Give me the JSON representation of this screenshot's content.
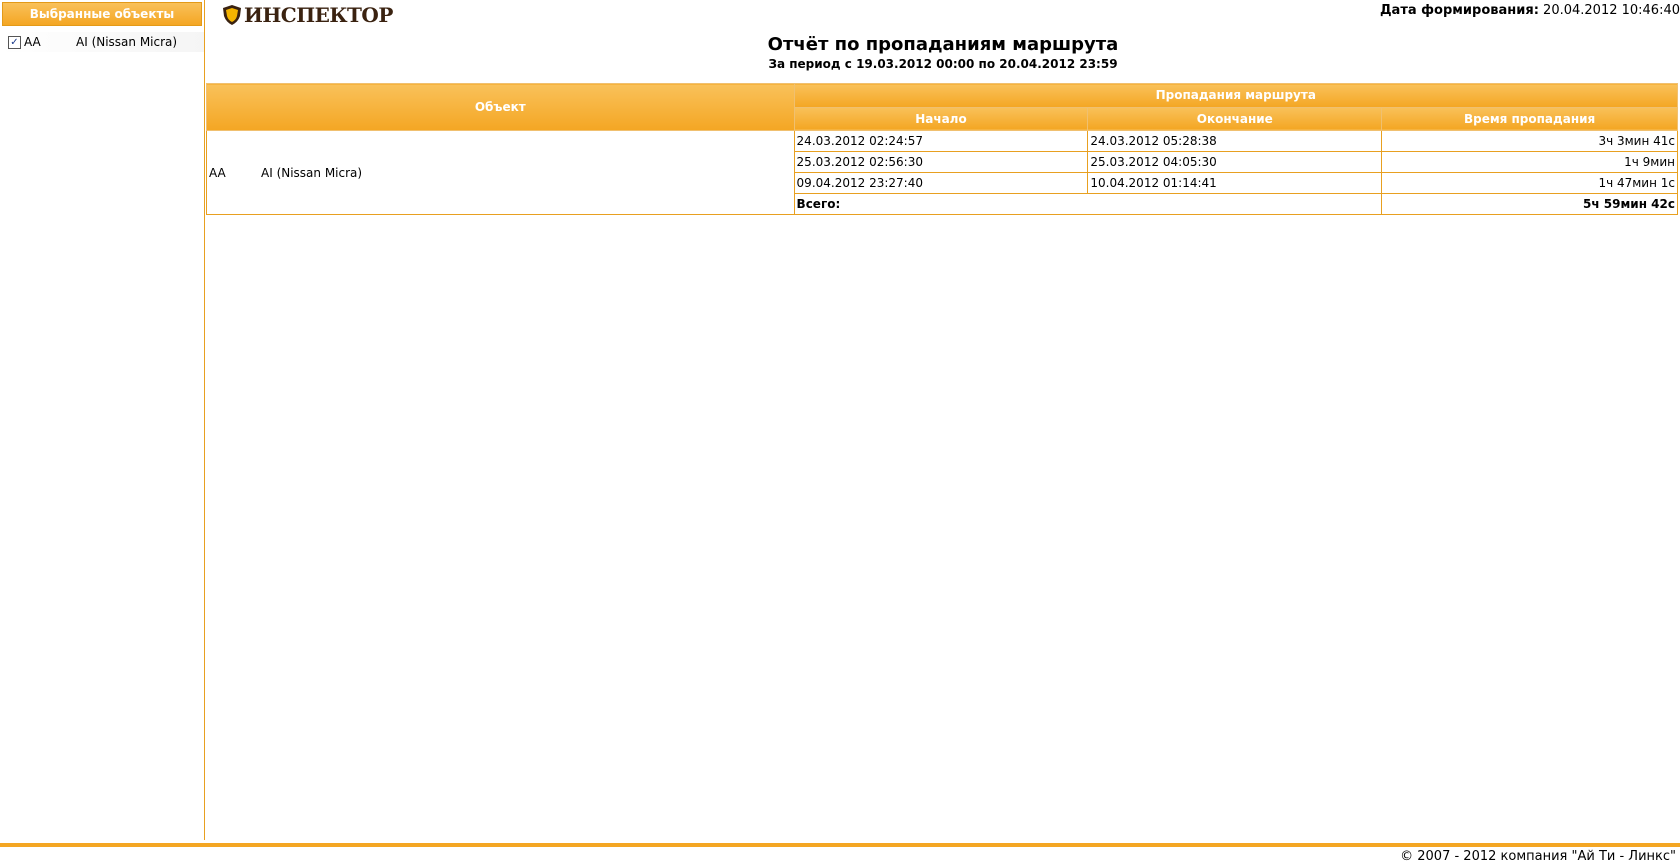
{
  "sidebar": {
    "title": "Выбранные объекты",
    "items": [
      {
        "checked": "✓",
        "code": "AA",
        "name": "AI (Nissan Micra)"
      }
    ]
  },
  "header": {
    "logo_text": "ИНСПЕКТОР",
    "generation_label": "Дата формирования:",
    "generation_value": "20.04.2012 10:46:40"
  },
  "report": {
    "title": "Отчёт по пропаданиям маршрута",
    "period": "За период с 19.03.2012 00:00 по 20.04.2012 23:59",
    "columns": {
      "object": "Объект",
      "group": "Пропадания маршрута",
      "start": "Начало",
      "end": "Окончание",
      "duration": "Время пропадания"
    },
    "object_code": "AA",
    "object_name": "AI (Nissan Micra)",
    "rows": [
      {
        "start": "24.03.2012 02:24:57",
        "end": "24.03.2012 05:28:38",
        "duration": "3ч 3мин 41с"
      },
      {
        "start": "25.03.2012 02:56:30",
        "end": "25.03.2012 04:05:30",
        "duration": "1ч 9мин"
      },
      {
        "start": "09.04.2012 23:27:40",
        "end": "10.04.2012 01:14:41",
        "duration": "1ч 47мин 1с"
      }
    ],
    "total_label": "Всего:",
    "total_value": "5ч 59мин 42с"
  },
  "footer": {
    "copyright": "© 2007 - 2012 компания \"Ай Ти - Линкс\""
  },
  "colors": {
    "accent": "#f4a623",
    "border": "#e8a020",
    "logo": "#3a2210"
  }
}
